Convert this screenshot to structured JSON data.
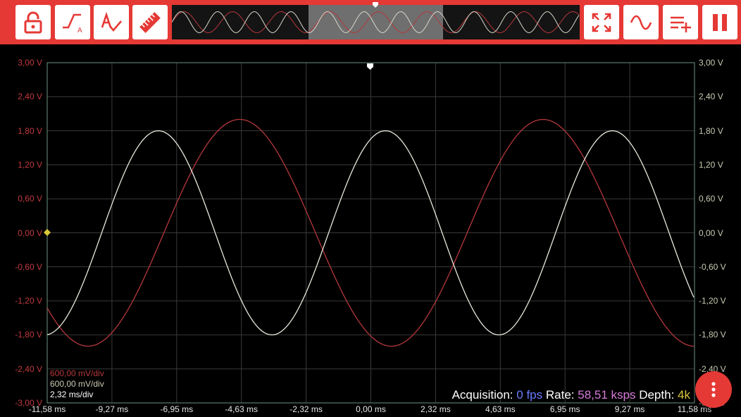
{
  "toolbar": {
    "buttons_left": [
      {
        "name": "lock-icon"
      },
      {
        "name": "trigger-icon"
      },
      {
        "name": "auto-measure-icon"
      },
      {
        "name": "ruler-icon"
      }
    ],
    "buttons_right": [
      {
        "name": "fullscreen-icon"
      },
      {
        "name": "waveform-icon"
      },
      {
        "name": "add-list-icon"
      },
      {
        "name": "pause-icon"
      }
    ]
  },
  "scope": {
    "y_labels": [
      "3,00 V",
      "2,40 V",
      "1,80 V",
      "1,20 V",
      "0,60 V",
      "0,00 V",
      "-0,60 V",
      "-1,20 V",
      "-1,80 V",
      "-2,40 V",
      "-3,00 V"
    ],
    "x_labels": [
      "-11,58 ms",
      "-9,27 ms",
      "-6,95 ms",
      "-4,63 ms",
      "-2,32 ms",
      "0,00 ms",
      "2,32 ms",
      "4,63 ms",
      "6,95 ms",
      "9,27 ms",
      "11,58 ms"
    ],
    "ch1_scale": "600,00 mV/div",
    "ch2_scale": "600,00 mV/div",
    "time_scale": "2,32 ms/div",
    "colors": {
      "ch1": "#b5383c",
      "ch2": "#e8e8dc",
      "grid": "#3a3a3a",
      "border": "#5a7a6a",
      "trigger": "#d8c83a"
    }
  },
  "status": {
    "acq_label": "Acquisition:",
    "acq_value": "0 fps",
    "rate_label": "Rate:",
    "rate_value": "58,51 ksps",
    "depth_label": "Depth:",
    "depth_value": "4k"
  },
  "fab": {
    "icon": "more-vert-icon"
  }
}
